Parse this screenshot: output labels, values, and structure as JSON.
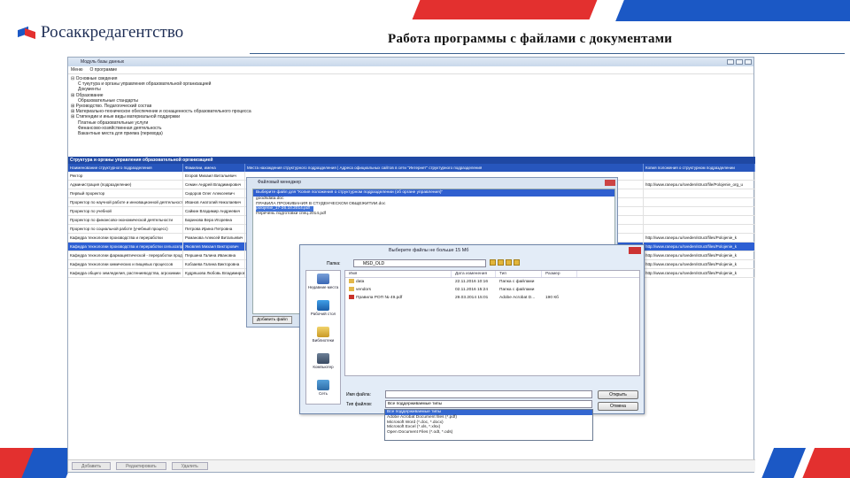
{
  "slide": {
    "logo_text": "Росаккредагентство",
    "title": "Работа программы с файлами с документами"
  },
  "colors": {
    "accent_red": "#e3302f",
    "accent_blue": "#1b58c5",
    "grid_header": "#2756bd"
  },
  "app": {
    "window_title": "Модуль базы данных",
    "menu": [
      "Меню",
      "О программе"
    ],
    "tree": [
      {
        "level": 0,
        "label": "⊟ Основные сведения"
      },
      {
        "level": 1,
        "label": "С тукутура и органы управления образовательной организацией"
      },
      {
        "level": 1,
        "label": "Документы"
      },
      {
        "level": 0,
        "label": "⊞ Образование"
      },
      {
        "level": 1,
        "label": "Образовательные стандарты"
      },
      {
        "level": 0,
        "label": "⊞ Руководство. Педагогический состав"
      },
      {
        "level": 0,
        "label": "⊞ Материально-техническое обеспечение и оснащенность образовательного процесса"
      },
      {
        "level": 0,
        "label": "⊞ Стипендии и иные виды материальной поддержки"
      },
      {
        "level": 1,
        "label": "Платные образовательные услуги"
      },
      {
        "level": 1,
        "label": "Финансово-хозяйственная деятельность"
      },
      {
        "level": 1,
        "label": "Вакантные места для приема (перевода)"
      }
    ],
    "grid_caption": "Структура и органы управления образовательной организацией",
    "grid_columns": [
      "Наименование структурного подразделения",
      "Фамилии, имена",
      "Места нахождения структурного подразделения | Адреса официальных сайтов в сети \"Интернет\" структурного подразделения",
      "Копия положения о структурном подразделении"
    ],
    "grid_rows": [
      {
        "c1": "Ректор",
        "c2": "Егоров Михаил Витальевич",
        "c3": "",
        "c4": "",
        "selected": false
      },
      {
        "c1": "Администрация (подразделение)",
        "c2": "Семин Андрей Владимирович",
        "c3": "",
        "c4": "http://www.ranepa.ru/sveden/struct/file/Polojenie_org_u",
        "selected": false
      },
      {
        "c1": "Первый проректор",
        "c2": "Сидоров Олег Алексеевич",
        "c3": "",
        "c4": "",
        "selected": false
      },
      {
        "c1": "Проректор по научной работе и инновационной деятельности",
        "c2": "Иванов Анатолий Николаевич",
        "c3": "",
        "c4": "",
        "selected": false
      },
      {
        "c1": "Проректор по учебной",
        "c2": "Сайкин Владимир Андреевич",
        "c3": "",
        "c4": "",
        "selected": false
      },
      {
        "c1": "Проректор по финансово-экономической деятельности",
        "c2": "Баринова Вера Игоревна",
        "c3": "",
        "c4": "",
        "selected": false
      },
      {
        "c1": "Проректор по социальной работе (учебный процесс)",
        "c2": "Петрова Ирина Петровна",
        "c3": "",
        "c4": "",
        "selected": false
      },
      {
        "c1": "Кафедра технологии производства и переработки",
        "c2": "Романова Алексей Витальевич",
        "c3": "",
        "c4": "http://www.ranepa.ru/sveden/struct/files/Polojenie_k",
        "selected": false
      },
      {
        "c1": "Кафедра технологии производства и переработки сельхозпродукции",
        "c2": "Яковлев Михаил Викторович",
        "c3": "",
        "c4": "http://www.ranepa.ru/sveden/struct/files/Polojenie_k",
        "selected": true
      },
      {
        "c1": "Кафедра технологии фармацевтической - переработки продукции",
        "c2": "Першина Галина Ивановна",
        "c3": "",
        "c4": "http://www.ranepa.ru/sveden/struct/files/Polojenie_k",
        "selected": false
      },
      {
        "c1": "Кафедра технологии химических и пищевых процессов",
        "c2": "Кобзаева Галина Викторовна",
        "c3": "",
        "c4": "http://www.ranepa.ru/sveden/struct/files/Polojenie_k",
        "selected": false
      },
      {
        "c1": "Кафедра общего земледелия, растениеводства, агрохимии",
        "c2": "Кудряшова Любовь Владимировна",
        "c3": "",
        "c4": "http://www.ranepa.ru/sveden/struct/files/Polojenie_k",
        "selected": false
      }
    ],
    "bottom_buttons": [
      "Добавить",
      "Редактировать",
      "Удалить"
    ]
  },
  "file_manager": {
    "title": "Файловый менеджер",
    "header": "Выберите файл для \"Копия положения о структурном подразделении (об органе управления)\"",
    "files": [
      {
        "name": "goodsdata.doc",
        "highlighted": false
      },
      {
        "name": "ПРАВИЛА ПРОЖИВАНИЯ В СТУДЕНЧЕСКОМ ОБЩЕЖИТИИ.doc",
        "highlighted": false
      },
      {
        "name": "polojenie_17-26.10.2014.pdf",
        "highlighted": true
      },
      {
        "name": "Перечень подготовки спец.2014.pdf",
        "highlighted": false
      }
    ],
    "add_button": "Добавить файл"
  },
  "open_dialog": {
    "title": "Выберите файлы не больше 15 Мб",
    "folder_label": "Папка:",
    "folder_value": "MSD_OLD",
    "places": [
      {
        "label": "Недавние места",
        "icon": "recent-places-icon"
      },
      {
        "label": "Рабочий стол",
        "icon": "desktop-icon"
      },
      {
        "label": "Библиотеки",
        "icon": "libraries-icon"
      },
      {
        "label": "Компьютер",
        "icon": "computer-icon"
      },
      {
        "label": "Сеть",
        "icon": "network-icon"
      }
    ],
    "columns": [
      "Имя",
      "Дата изменения",
      "Тип",
      "Размер"
    ],
    "files": [
      {
        "name": "data",
        "date": "22.11.2016 10:16",
        "type": "Папка с файлами",
        "size": "",
        "icon": "folder-icon"
      },
      {
        "name": "vendors",
        "date": "02.11.2016 15:24",
        "type": "Папка с файлами",
        "size": "",
        "icon": "folder-icon"
      },
      {
        "name": "Правила РОП № 49.pdf",
        "date": "29.03.2014 15:01",
        "type": "Adobe Acrobat D...",
        "size": "190 Кб",
        "icon": "pdf-file-icon"
      }
    ],
    "filename_label": "Имя файла:",
    "filename_value": "",
    "filetype_label": "Тип файлов:",
    "filetype_value": "Все поддерживаемые типы",
    "open_button": "Открыть",
    "cancel_button": "Отмена",
    "filetype_options": [
      "Все поддерживаемые типы",
      "Adobe Acrobat Document files (*.pdf)",
      "Microsoft Word (*.doc, *.docx)",
      "Microsoft Excel (*.xls, *.xlsx)",
      "Open Document Files (*.odt, *.ods)"
    ]
  }
}
